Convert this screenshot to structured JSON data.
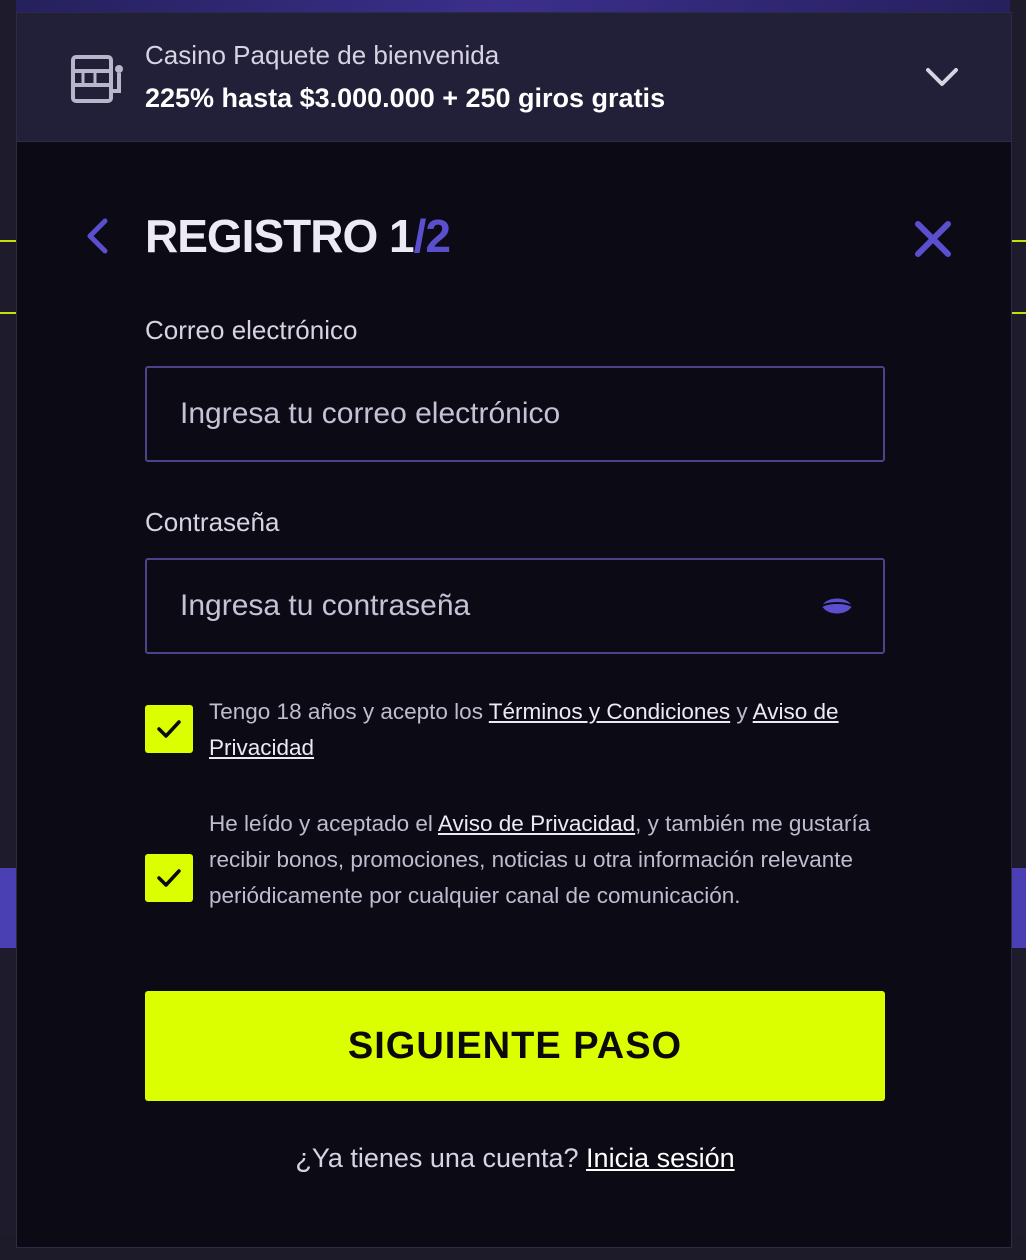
{
  "promo": {
    "subtitle": "Casino Paquete de bienvenida",
    "headline": "225% hasta $3.000.000 + 250 giros gratis"
  },
  "register": {
    "title": "REGISTRO",
    "step_current": "1",
    "step_separator": "/",
    "step_total": "2"
  },
  "form": {
    "email": {
      "label": "Correo electrónico",
      "placeholder": "Ingresa tu correo electrónico"
    },
    "password": {
      "label": "Contraseña",
      "placeholder": "Ingresa tu contraseña"
    },
    "consent_terms": {
      "checked": true,
      "prefix": "Tengo 18 años y acepto los ",
      "terms_link": "Términos y Condiciones",
      "middle": " y ",
      "privacy_link": "Aviso de Privacidad"
    },
    "consent_marketing": {
      "checked": true,
      "prefix": "He leído y aceptado el ",
      "privacy_link": "Aviso de Privacidad",
      "suffix": ", y también me gustaría recibir bonos, promociones, noticias u otra información relevante periódicamente por cualquier canal de comunicación."
    },
    "submit_label": "SIGUIENTE PASO"
  },
  "footer": {
    "question": "¿Ya tienes una cuenta? ",
    "login_link": "Inicia sesión"
  },
  "colors": {
    "accent_lime": "#dcff00",
    "accent_purple": "#5b4fcf",
    "modal_bg": "#0c0b15",
    "promo_bg": "#221f38"
  },
  "icons": {
    "promo": "slot-machine-icon",
    "expand": "chevron-down-icon",
    "back": "chevron-left-icon",
    "close": "close-icon",
    "password_toggle": "eye-icon",
    "checkbox": "checkmark-icon"
  }
}
